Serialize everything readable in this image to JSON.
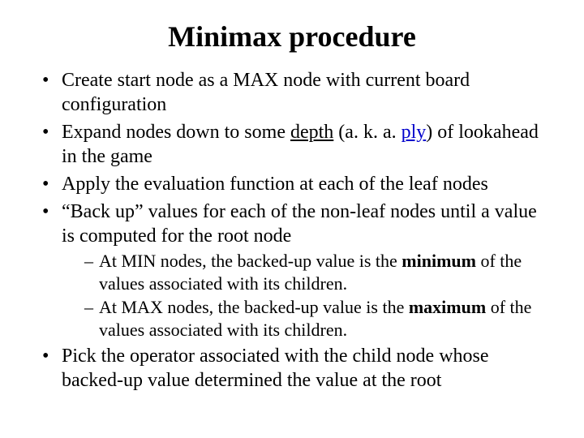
{
  "title": "Minimax procedure",
  "b1_a": "Create start node as a MAX node  with current board configuration",
  "b2_a": "Expand nodes down to some ",
  "b2_depth": "depth",
  "b2_b": " (a. k. a. ",
  "b2_ply": "ply",
  "b2_c": ") of lookahead in the game",
  "b3_a": "Apply the evaluation function at each of the leaf nodes",
  "b4_a": "“Back up” values for each of the non-leaf nodes until a value is computed for the root node",
  "s1_a": "At MIN nodes, the backed-up value is the ",
  "s1_min": "minimum",
  "s1_b": " of the values associated with its children.",
  "s2_a": "At MAX nodes, the backed-up value is the ",
  "s2_max": "maximum",
  "s2_b": " of the values associated with its children.",
  "b5_a": "Pick the operator associated with the child node whose backed-up value determined the value at the root"
}
